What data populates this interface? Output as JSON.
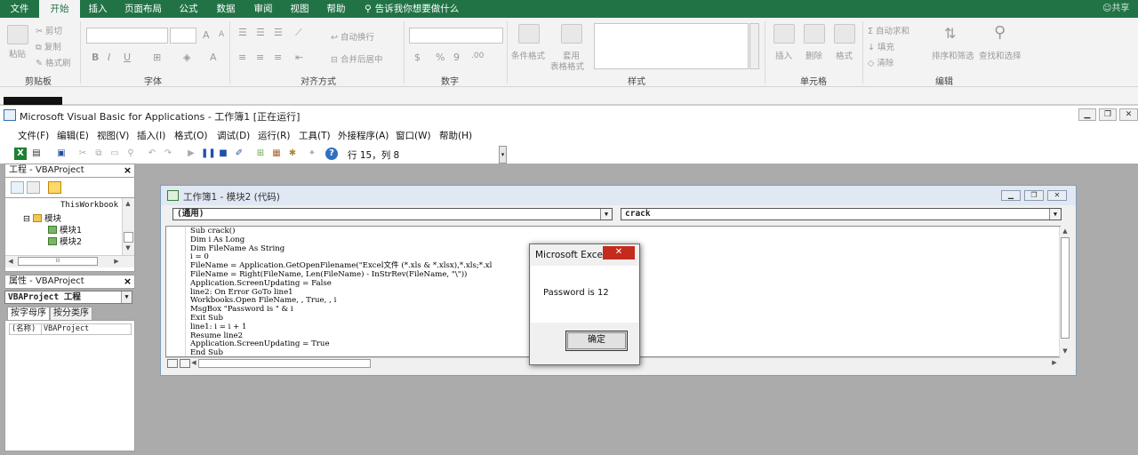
{
  "excel": {
    "tabs": [
      "文件",
      "开始",
      "插入",
      "页面布局",
      "公式",
      "数据",
      "审阅",
      "视图",
      "帮助"
    ],
    "active_tab": "开始",
    "tell_me": "告诉我你想要做什么",
    "account": "共享",
    "clipboard": {
      "paste": "粘贴",
      "cut": "剪切",
      "copy": "复制",
      "format_painter": "格式刷",
      "label": "剪贴板"
    },
    "font": {
      "bold": "B",
      "italic": "I",
      "underline": "U",
      "grow": "A",
      "shrink": "A",
      "font_color": "A",
      "label": "字体"
    },
    "alignment": {
      "wrap": "自动换行",
      "merge": "合并后居中",
      "label": "对齐方式"
    },
    "number": {
      "currency": "$",
      "percent": "%",
      "comma": "9",
      "inc_decimal": ".00",
      "label": "数字"
    },
    "styles": {
      "conditional": "条件格式",
      "table_top": "套用",
      "table_bottom": "表格格式",
      "label": "样式"
    },
    "cells": {
      "insert": "插入",
      "delete": "删除",
      "format": "格式",
      "label": "单元格"
    },
    "editing": {
      "autosum": "自动求和",
      "fill": "填充",
      "clear": "清除",
      "sort": "排序和筛选",
      "find": "查找和选择",
      "label": "编辑"
    }
  },
  "vba": {
    "title": "Microsoft Visual Basic for Applications - 工作簿1 [正在运行]",
    "menu": [
      "文件(F)",
      "编辑(E)",
      "视图(V)",
      "插入(I)",
      "格式(O)",
      "调试(D)",
      "运行(R)",
      "工具(T)",
      "外接程序(A)",
      "窗口(W)",
      "帮助(H)"
    ],
    "position": "行 15，列 8",
    "project_pane": {
      "title": "工程 - VBAProject",
      "close": "×",
      "tree": [
        "ThisWorkbook",
        "模块",
        "模块1",
        "模块2"
      ],
      "scroll_mark": "III"
    },
    "properties_pane": {
      "title": "属性 - VBAProject",
      "close": "×",
      "object": "VBAProject 工程",
      "tabs": [
        "按字母序",
        "按分类序"
      ],
      "row_key": "(名称)",
      "row_value": "VBAProject"
    },
    "code_window": {
      "title": "工作簿1 - 模块2 (代码)",
      "object_combo": "(通用)",
      "proc_combo": "crack",
      "lines": [
        "Sub crack()",
        "Dim i As Long",
        "Dim FileName As String",
        "i = 0",
        "FileName = Application.GetOpenFilename(\"Excel文件 (*.xls & *.xlsx),*.xls;*.xl",
        "FileName = Right(FileName, Len(FileName) - InStrRev(FileName, \"\\\"))",
        "Application.ScreenUpdating = False",
        "line2: On Error GoTo line1",
        "Workbooks.Open FileName, , True, , i",
        "MsgBox \"Password is \" & i",
        "Exit Sub",
        "line1: i = i + 1",
        "Resume line2",
        "Application.ScreenUpdating = True",
        "End Sub"
      ]
    },
    "msgbox": {
      "title": "Microsoft Excel",
      "close": "✕",
      "message": "Password is 12",
      "ok": "确定"
    }
  }
}
